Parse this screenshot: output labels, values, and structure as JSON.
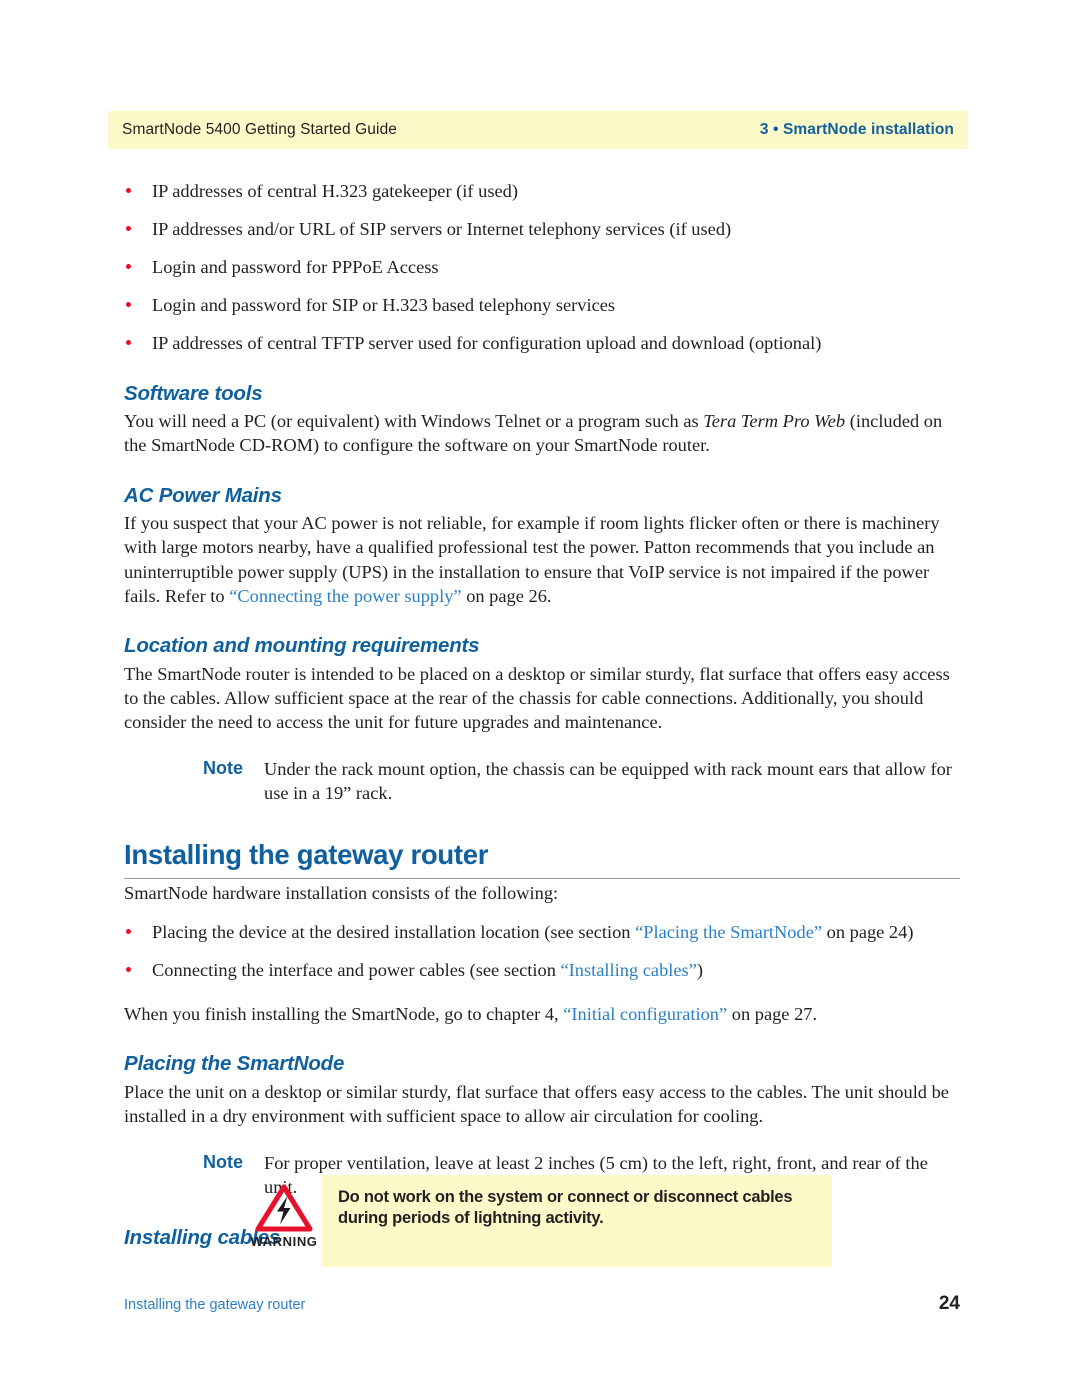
{
  "header": {
    "left": "SmartNode 5400 Getting Started Guide",
    "right": "3 • SmartNode installation"
  },
  "requirements_bullets": [
    "IP addresses of central H.323 gatekeeper (if used)",
    "IP addresses and/or URL of SIP servers or Internet telephony services (if used)",
    "Login and password for PPPoE Access",
    "Login and password for SIP or H.323 based telephony services",
    "IP addresses of central TFTP server used for configuration upload and download (optional)"
  ],
  "software_tools": {
    "heading": "Software tools",
    "para_before": "You will need a PC (or equivalent) with Windows Telnet or a program such as ",
    "para_italic": "Tera Term Pro Web",
    "para_after": " (included on the SmartNode CD-ROM) to configure the software on your SmartNode router."
  },
  "ac_power": {
    "heading": "AC Power Mains",
    "para_before": "If you suspect that your AC power is not reliable, for example if room lights flicker often or there is machinery with large motors nearby, have a qualified professional test the power. Patton recommends that you include an uninterruptible power supply (UPS) in the installation to ensure that VoIP service is not impaired if the power fails. Refer to ",
    "xref": "“Connecting the power supply”",
    "para_after": " on page 26."
  },
  "location": {
    "heading": "Location and mounting requirements",
    "para": "The SmartNode router is intended to be placed on a desktop or similar sturdy, flat surface that offers easy access to the cables. Allow sufficient space at the rear of the chassis for cable connections. Additionally, you should consider the need to access the unit for future upgrades and maintenance.",
    "note_label": "Note",
    "note_body": "Under the rack mount option, the chassis can be equipped with rack mount ears that allow for use in a 19” rack."
  },
  "installing_gateway": {
    "heading": "Installing the gateway router",
    "intro": "SmartNode hardware installation consists of the following:",
    "bullets": [
      {
        "before": "Placing the device at the desired installation location (see section ",
        "xref": "“Placing the SmartNode”",
        "after": " on page 24)"
      },
      {
        "before": "Connecting the interface and power cables (see section ",
        "xref": "“Installing cables”",
        "after": ")"
      }
    ],
    "closing_before": "When you finish installing the SmartNode, go to chapter 4, ",
    "closing_xref": "“Initial configuration”",
    "closing_after": " on page 27."
  },
  "placing": {
    "heading": "Placing the SmartNode",
    "para": "Place the unit on a desktop or similar sturdy, flat surface that offers easy access to the cables. The unit should be installed in a dry environment with sufficient space to allow air circulation for cooling.",
    "note_label": "Note",
    "note_body": "For proper ventilation, leave at least 2 inches (5 cm) to the left, right, front, and rear of the unit."
  },
  "installing_cables": {
    "heading": "Installing cables"
  },
  "warning": {
    "icon_label": "WARNING",
    "text": "Do not work on the system or connect or disconnect cables during periods of lightning activity."
  },
  "footer": {
    "left": "Installing the gateway router",
    "page_number": "24"
  },
  "colors": {
    "heading_blue": "#10609f",
    "xref_blue": "#2b7fc4",
    "band_yellow": "#fdfac9",
    "bullet_red": "#e8112d",
    "warning_red": "#e8112d",
    "body_black": "#231f20"
  }
}
